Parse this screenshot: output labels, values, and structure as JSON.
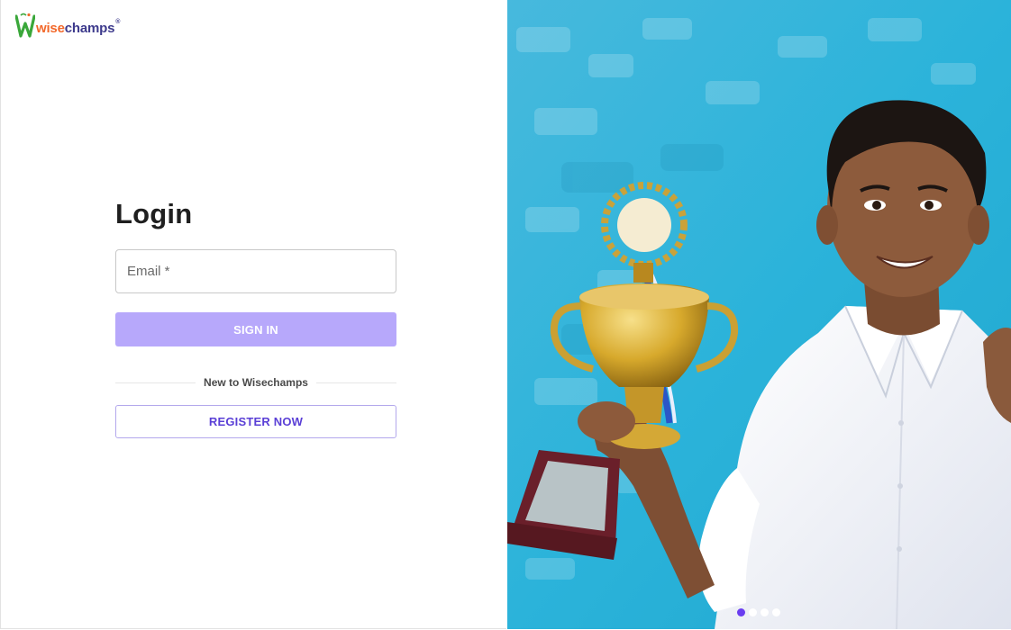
{
  "brand": {
    "logo_prefix": "wise",
    "logo_suffix": "champs",
    "registered_mark": "®",
    "colors": {
      "wise": "#f2682a",
      "champs": "#3d3a8c",
      "mark": "#3aa73a"
    }
  },
  "login": {
    "title": "Login",
    "email_placeholder": "Email *",
    "email_value": "",
    "signin_label": "SIGN IN",
    "divider_text": "New to Wisechamps",
    "register_label": "REGISTER NOW"
  },
  "colors": {
    "signin_bg": "#b7a8fb",
    "register_text": "#5a3fd6",
    "hero_bg": "#2fb6d8",
    "dot_active": "#6a3df0"
  },
  "carousel": {
    "slide_count": 4,
    "active_index": 0
  }
}
